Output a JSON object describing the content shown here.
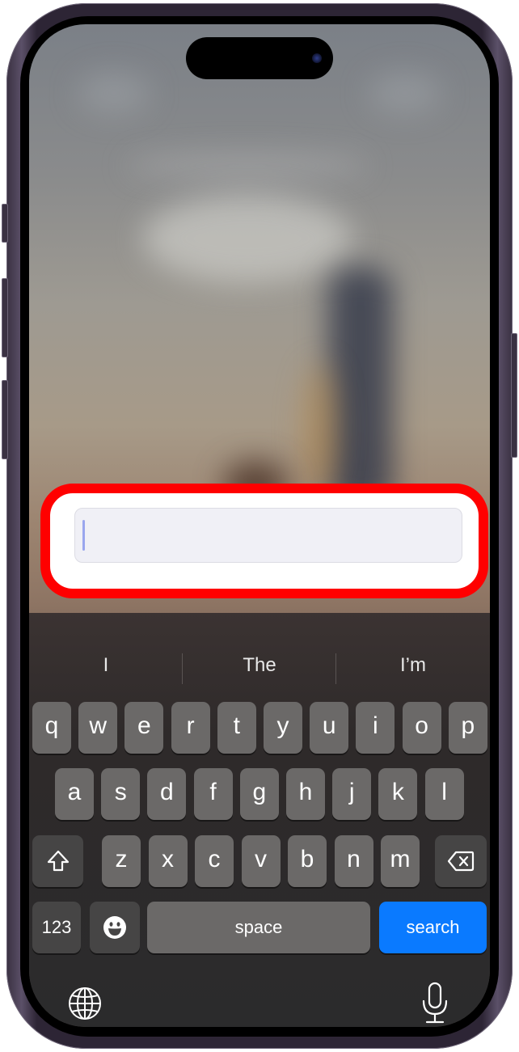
{
  "device": {
    "model": "iPhone with Dynamic Island",
    "frame_color": "#3a3142"
  },
  "search_field": {
    "value": "",
    "placeholder": "",
    "focused": true,
    "highlight_color": "#ff0000"
  },
  "suggestions": [
    "I",
    "The",
    "I’m"
  ],
  "keyboard": {
    "row1": [
      "q",
      "w",
      "e",
      "r",
      "t",
      "y",
      "u",
      "i",
      "o",
      "p"
    ],
    "row2": [
      "a",
      "s",
      "d",
      "f",
      "g",
      "h",
      "j",
      "k",
      "l"
    ],
    "row3": [
      "z",
      "x",
      "c",
      "v",
      "b",
      "n",
      "m"
    ],
    "numbers_label": "123",
    "space_label": "space",
    "return_label": "search",
    "return_color": "#0a7aff",
    "icons": {
      "shift": "shift-icon",
      "delete": "delete-icon",
      "emoji": "emoji-icon",
      "globe": "globe-icon",
      "mic": "microphone-icon"
    }
  }
}
